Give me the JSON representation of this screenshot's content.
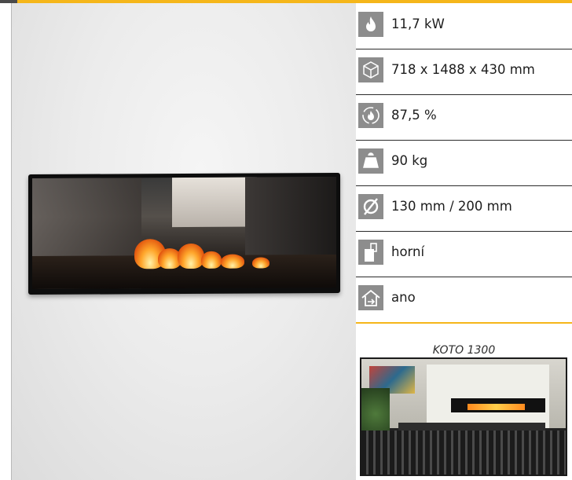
{
  "specs": [
    {
      "icon": "flame-icon",
      "value": "11,7 kW"
    },
    {
      "icon": "dimensions-cube-icon",
      "value": "718 x 1488 x 430 mm"
    },
    {
      "icon": "efficiency-cycle-icon",
      "value": "87,5 %"
    },
    {
      "icon": "weight-icon",
      "value": "90 kg"
    },
    {
      "icon": "diameter-icon",
      "value": "130 mm / 200 mm"
    },
    {
      "icon": "flue-outlet-icon",
      "value": "horní"
    },
    {
      "icon": "home-icon",
      "value": "ano"
    }
  ],
  "model_name": "KOTO 1300",
  "colors": {
    "accent": "#f5b61a",
    "icon_bg": "#8d8d8d",
    "text": "#1d1d1d"
  }
}
